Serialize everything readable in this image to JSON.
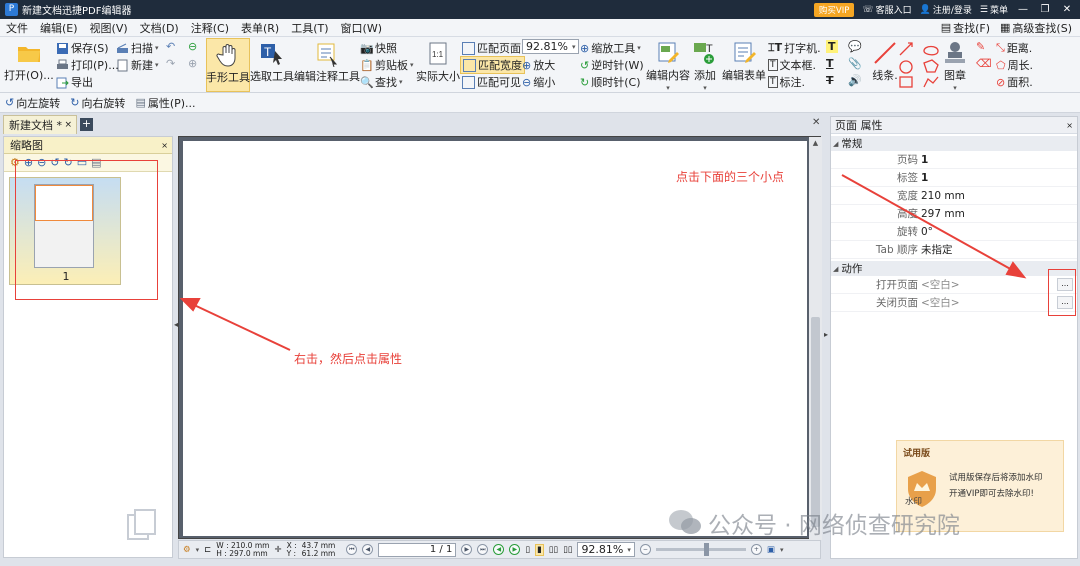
{
  "window": {
    "title": "新建文档迅捷PDF编辑器",
    "vip_label": "购买VIP",
    "service_label": "客服入口",
    "login_label": "注册/登录",
    "menu_label": "菜单",
    "minimize": "—",
    "restore": "❐",
    "close": "✕"
  },
  "menubar": {
    "items": [
      "文件",
      "编辑(E)",
      "视图(V)",
      "文档(D)",
      "注释(C)",
      "表单(R)",
      "工具(T)",
      "窗口(W)"
    ],
    "find_label": "查找(F)",
    "advanced_find_label": "高级查找(S)"
  },
  "ribbon": {
    "open": "打开(O)...",
    "save": "保存(S)",
    "print": "打印(P)...",
    "export": "导出",
    "scan": "扫描",
    "new": "新建",
    "hand": "手形工具",
    "select": "选取工具",
    "edit_annot": "编辑注释工具",
    "snapshot": "快照",
    "clipboard": "剪贴板",
    "find": "查找",
    "actual_size": "实际大小",
    "fit_page": "匹配页面",
    "fit_width": "匹配宽度",
    "fit_visible": "匹配可见",
    "zoom_value": "92.81%",
    "zoom_in": "放大",
    "zoom_out": "缩小",
    "zoom_tool": "缩放工具",
    "ccw": "逆时针(W)",
    "cw": "顺时针(C)",
    "edit_content": "编辑内容",
    "add": "添加",
    "edit_form": "编辑表单",
    "typewriter": "打字机.",
    "textbox": "文本框.",
    "callout": "标注.",
    "lines": "线条.",
    "stamp": "图章",
    "distance": "距离.",
    "perimeter": "周长.",
    "area": "面积."
  },
  "toolbar2": {
    "rotate_left": "向左旋转",
    "rotate_right": "向右旋转",
    "properties": "属性(P)..."
  },
  "tabs": {
    "doc_tab": "新建文档 *",
    "tab_close": "×",
    "add": "+",
    "strip_close": "✕"
  },
  "thumbnail": {
    "title": "缩略图",
    "close": "×",
    "page_number": "1"
  },
  "statusbar": {
    "w_label": "W : 210.0 mm",
    "h_label": "H : 297.0 mm",
    "x_label": "X :",
    "y_label": "Y :",
    "x_value": "43.7 mm",
    "y_value": "61.2 mm",
    "page_display": "1 / 1",
    "zoom_value": "92.81%"
  },
  "properties": {
    "title": "页面 属性",
    "close": "×",
    "section_general": "常规",
    "section_actions": "动作",
    "rows": [
      {
        "label": "页码",
        "value": "1"
      },
      {
        "label": "标签",
        "value": "1"
      },
      {
        "label": "宽度",
        "value": "210 mm"
      },
      {
        "label": "高度",
        "value": "297 mm"
      },
      {
        "label": "旋转",
        "value": "0°"
      },
      {
        "label": "Tab 顺序",
        "value": "未指定"
      }
    ],
    "actions": [
      {
        "label": "打开页面",
        "value": "<空白>"
      },
      {
        "label": "关闭页面",
        "value": "<空白>"
      }
    ],
    "more_button": "..."
  },
  "trial": {
    "title": "试用版",
    "line1": "试用版保存后将添加水印",
    "line2": "开通VIP即可去除水印!",
    "line3": "水印"
  },
  "annotations": {
    "right_click_hint": "右击，然后点击属性",
    "dots_hint": "点击下面的三个小点",
    "color": "#e8413a"
  },
  "watermark": {
    "text": "公众号 · 网络侦查研究院"
  }
}
